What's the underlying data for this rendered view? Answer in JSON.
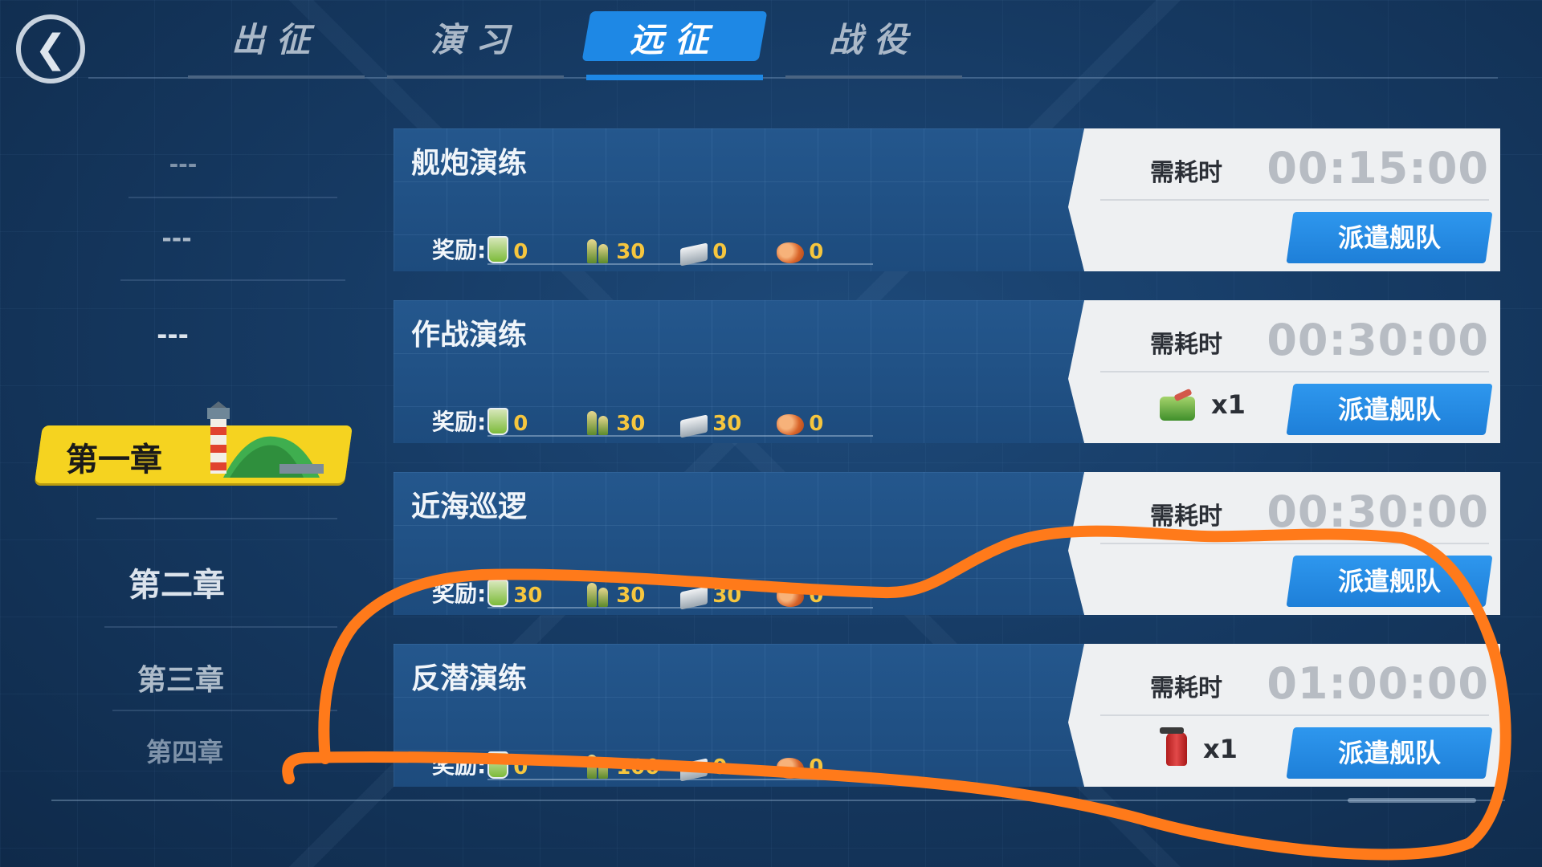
{
  "nav": {
    "back_icon": "chevron-left-icon",
    "tabs": [
      {
        "label": "出征",
        "active": false
      },
      {
        "label": "演习",
        "active": false
      },
      {
        "label": "远征",
        "active": true
      },
      {
        "label": "战役",
        "active": false
      }
    ]
  },
  "chapters": {
    "items": [
      "---",
      "---",
      "---",
      "第一章",
      "第二章",
      "第三章",
      "第四章"
    ],
    "active_index": 3
  },
  "missions": [
    {
      "name": "舰炮演练",
      "rewards_label": "奖励:",
      "rewards": {
        "fuel": "0",
        "ammo": "30",
        "steel": "0",
        "bauxite": "0"
      },
      "need_label": "需耗时",
      "time": "00:15:00",
      "requirement": null,
      "dispatch_label": "派遣舰队"
    },
    {
      "name": "作战演练",
      "rewards_label": "奖励:",
      "rewards": {
        "fuel": "0",
        "ammo": "30",
        "steel": "30",
        "bauxite": "0"
      },
      "need_label": "需耗时",
      "time": "00:30:00",
      "requirement": {
        "icon": "fuel-drum-icon",
        "qty": "x1"
      },
      "dispatch_label": "派遣舰队"
    },
    {
      "name": "近海巡逻",
      "rewards_label": "奖励:",
      "rewards": {
        "fuel": "30",
        "ammo": "30",
        "steel": "30",
        "bauxite": "0"
      },
      "need_label": "需耗时",
      "time": "00:30:00",
      "requirement": null,
      "dispatch_label": "派遣舰队"
    },
    {
      "name": "反潜演练",
      "rewards_label": "奖励:",
      "rewards": {
        "fuel": "0",
        "ammo": "100",
        "steel": "0",
        "bauxite": "0"
      },
      "need_label": "需耗时",
      "time": "01:00:00",
      "requirement": {
        "icon": "fire-extinguisher-icon",
        "qty": "x1"
      },
      "dispatch_label": "派遣舰队"
    }
  ],
  "colors": {
    "accent": "#1e88e5",
    "chapter_highlight": "#f5d320",
    "reward_value": "#f6c63e",
    "annotation_stroke": "#ff7a1a"
  }
}
